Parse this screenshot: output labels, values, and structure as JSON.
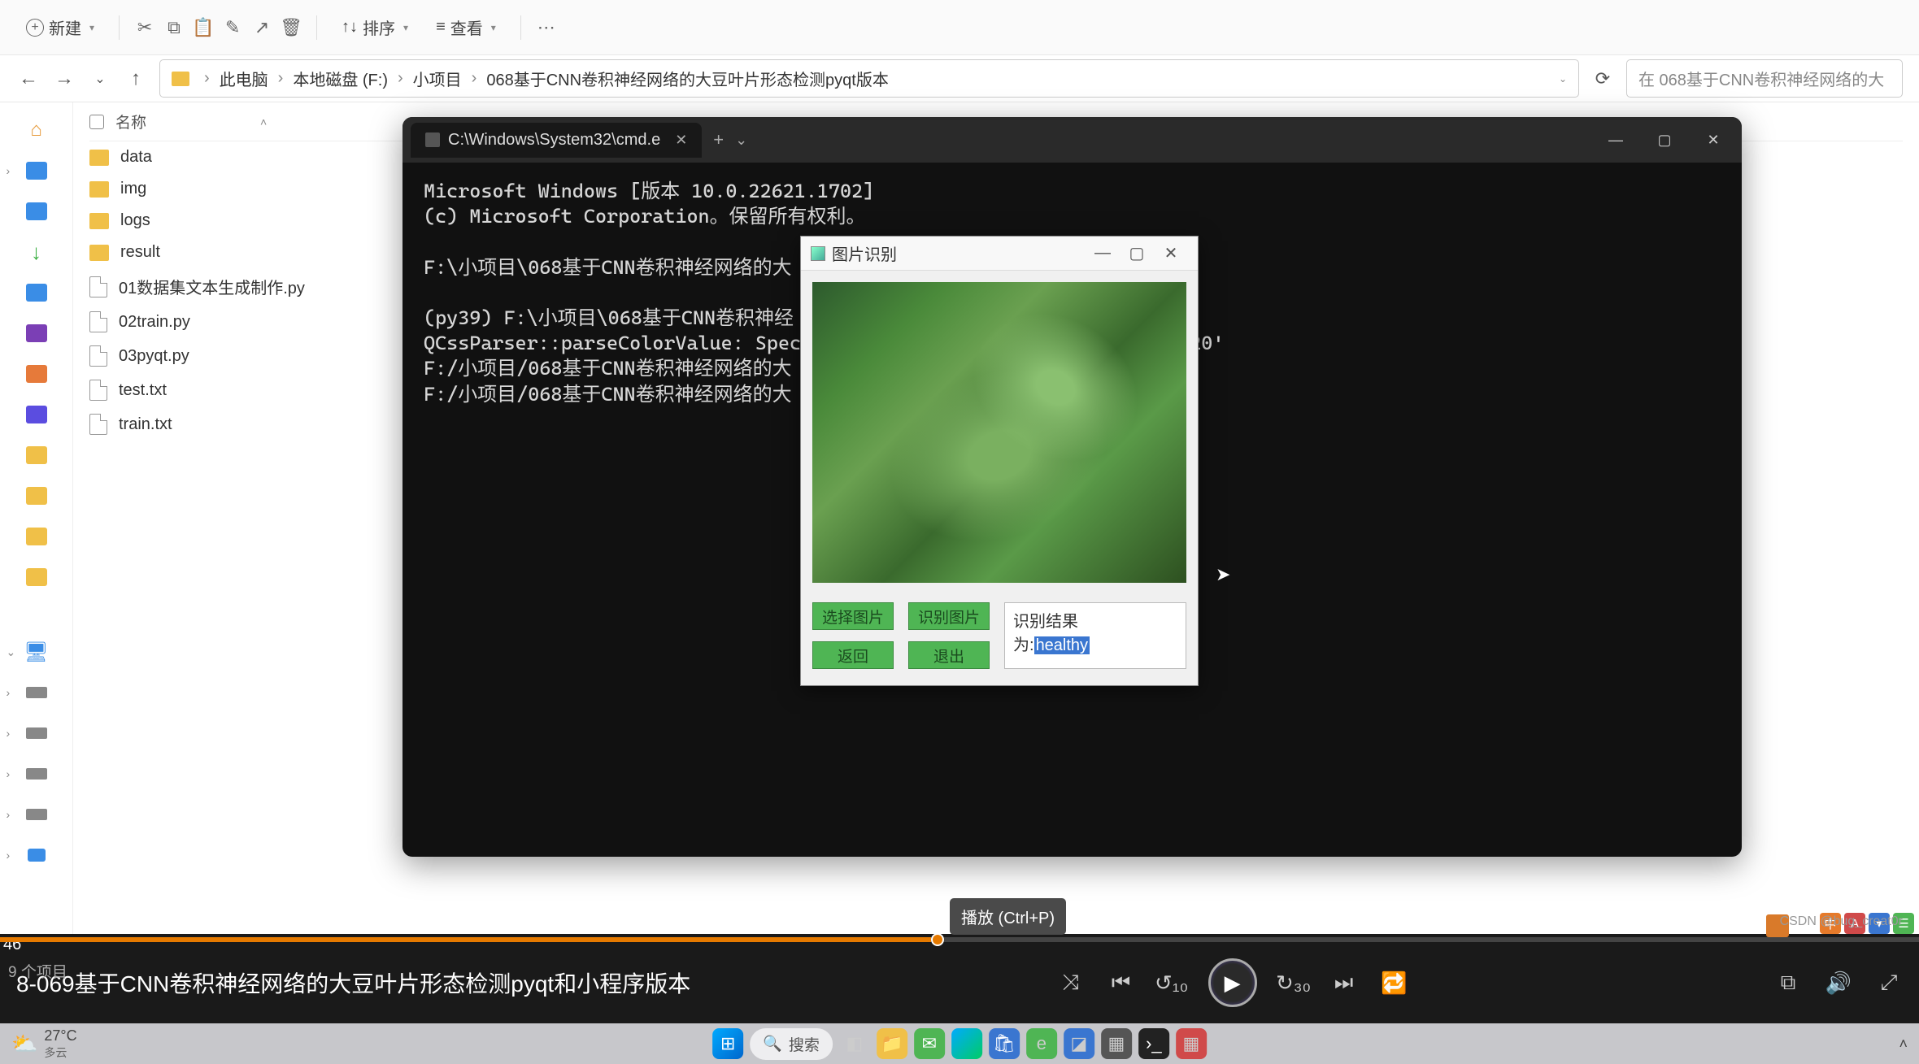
{
  "toolbar": {
    "new": "新建",
    "sort": "排序",
    "view": "查看"
  },
  "breadcrumb": {
    "parts": [
      "此电脑",
      "本地磁盘 (F:)",
      "小项目",
      "068基于CNN卷积神经网络的大豆叶片形态检测pyqt版本"
    ]
  },
  "search": {
    "placeholder": "在 068基于CNN卷积神经网络的大"
  },
  "file_header": {
    "name": "名称"
  },
  "files": [
    {
      "name": "data",
      "type": "folder"
    },
    {
      "name": "img",
      "type": "folder"
    },
    {
      "name": "logs",
      "type": "folder"
    },
    {
      "name": "result",
      "type": "folder"
    },
    {
      "name": "01数据集文本生成制作.py",
      "type": "file"
    },
    {
      "name": "02train.py",
      "type": "file"
    },
    {
      "name": "03pyqt.py",
      "type": "file"
    },
    {
      "name": "test.txt",
      "type": "file"
    },
    {
      "name": "train.txt",
      "type": "file"
    }
  ],
  "terminal": {
    "tab_title": "C:\\Windows\\System32\\cmd.e",
    "lines": "Microsoft Windows [版本 10.0.22621.1702]\n(c) Microsoft Corporation。保留所有权利。\n\nF:\\小项目\\068基于CNN卷积神经网络的大\n\n(py39) F:\\小项目\\068基于CNN卷积神经          03pyqt.py\nQCssParser::parseColorValue: Specif          ha given: 'rgb 0,0,0,120'\nF:/小项目/068基于CNN卷积神经网络的大          lar/caterpillar (2).jpg\nF:/小项目/068基于CNN卷积神经网络的大          healthy (2).jpg\n"
  },
  "pyqt": {
    "title": "图片识别",
    "btn_select": "选择图片",
    "btn_recognize": "识别图片",
    "btn_back": "返回",
    "btn_exit": "退出",
    "result_label": "识别结果",
    "result_prefix": "为:",
    "result_value": "healthy"
  },
  "player": {
    "time": "46",
    "tooltip": "播放 (Ctrl+P)",
    "title": "8-069基于CNN卷积神经网络的大豆叶片形态检测pyqt和小程序版本",
    "items": "9 个项目",
    "watermark": "CSDN @bug_creat0r"
  },
  "taskbar": {
    "temp": "27°C",
    "cond": "多云",
    "search": "搜索"
  }
}
